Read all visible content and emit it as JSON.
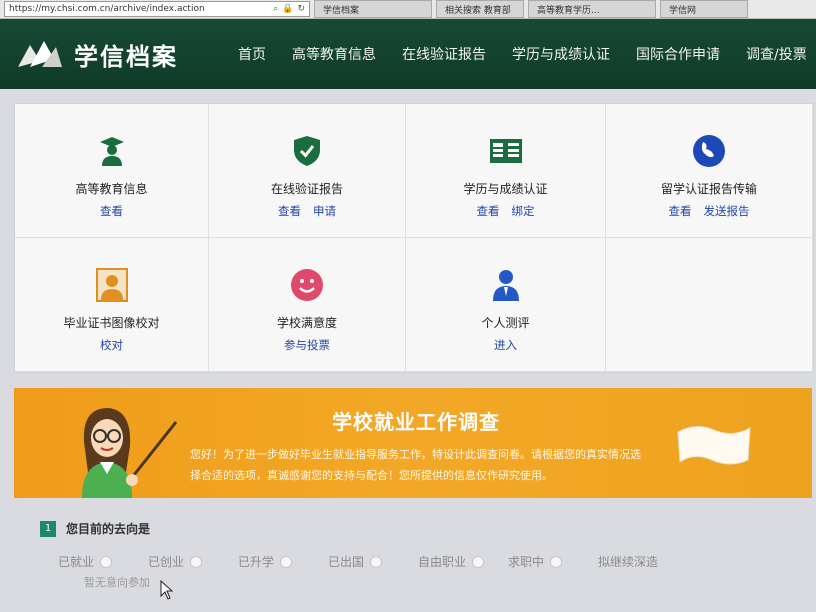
{
  "browser": {
    "url": "https://my.chsi.com.cn/archive/index.action",
    "tabs": [
      "学信档案",
      "相关搜索 教育部",
      "高等教育学历...",
      "学信网"
    ]
  },
  "header": {
    "logo_text": "学信档案",
    "nav": [
      "首页",
      "高等教育信息",
      "在线验证报告",
      "学历与成绩认证",
      "国际合作申请",
      "调查/投票"
    ]
  },
  "services": [
    {
      "title": "高等教育信息",
      "links": [
        "查看"
      ],
      "icon": "graduate-icon",
      "color": "#1a6d3f"
    },
    {
      "title": "在线验证报告",
      "links": [
        "查看",
        "申请"
      ],
      "icon": "shield-check-icon",
      "color": "#1a6d3f"
    },
    {
      "title": "学历与成绩认证",
      "links": [
        "查看",
        "绑定"
      ],
      "icon": "book-icon",
      "color": "#1a6d3f"
    },
    {
      "title": "留学认证报告传输",
      "links": [
        "查看",
        "发送报告"
      ],
      "icon": "globe-icon",
      "color": "#1d49b8"
    },
    {
      "title": "毕业证书图像校对",
      "links": [
        "校对"
      ],
      "icon": "portrait-icon",
      "color": "#e09020"
    },
    {
      "title": "学校满意度",
      "links": [
        "参与投票"
      ],
      "icon": "smiley-icon",
      "color": "#e04a6a"
    },
    {
      "title": "个人测评",
      "links": [
        "进入"
      ],
      "icon": "person-icon",
      "color": "#2259c4"
    }
  ],
  "banner": {
    "title": "学校就业工作调查",
    "text": "您好！为了进一步做好毕业生就业指导服务工作，特设计此调查问卷。请根据您的真实情况选择合适的选项，真诚感谢您的支持与配合！您所提供的信息仅作研究使用。"
  },
  "question": {
    "number": "1",
    "text": "您目前的去向是",
    "options": [
      "已就业",
      "已创业",
      "已升学",
      "已出国",
      "自由职业",
      "求职中",
      "拟继续深造"
    ],
    "sub_option": "暂无意向参加"
  },
  "colors": {
    "header_bg": "#174a33",
    "banner_bg": "#f2a826",
    "link": "#2246a8"
  }
}
